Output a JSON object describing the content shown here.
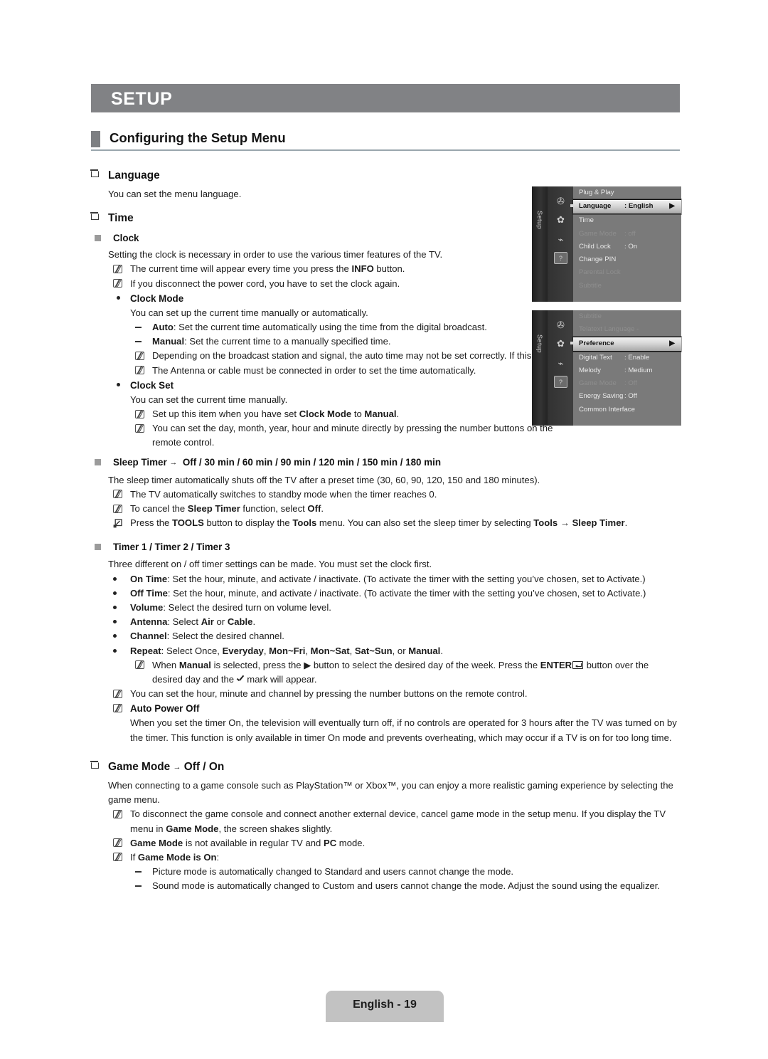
{
  "chapter": {
    "title": "SETUP"
  },
  "section": {
    "title": "Configuring the Setup Menu"
  },
  "footer": {
    "page_label": "English - 19"
  },
  "body": {
    "language": {
      "heading": "Language",
      "desc": "You can set the menu language."
    },
    "time": {
      "heading": "Time",
      "clock": {
        "heading": "Clock",
        "desc": "Setting the clock is necessary in order to use the various timer features of the TV.",
        "note1_a": "The current time will appear every time you press the ",
        "note1_b": "INFO",
        "note1_c": " button.",
        "note2": "If you disconnect the power cord, you have to set the clock again.",
        "clock_mode": {
          "heading": "Clock Mode",
          "desc": "You can set up the current time manually or automatically.",
          "auto_label": "Auto",
          "auto_text": ": Set the current time automatically using the time from the digital broadcast.",
          "manual_label": "Manual",
          "manual_text": ": Set the current time to a manually specified time.",
          "note1": "Depending on the broadcast station and signal, the auto time may not be set correctly. If this occurs, set the time manually.",
          "note2": "The Antenna or cable must be connected in order to set the time automatically."
        },
        "clock_set": {
          "heading": "Clock Set",
          "desc": "You can set the current time manually.",
          "note1_a": "Set up this item when you have set ",
          "note1_b": "Clock Mode",
          "note1_c": " to ",
          "note1_d": "Manual",
          "note1_e": ".",
          "note2": "You can set the day, month, year, hour and minute directly by pressing the number buttons on the remote control."
        }
      },
      "sleep_timer": {
        "heading_label": "Sleep Timer",
        "heading_arrow": "→",
        "heading_options": "Off / 30 min / 60 min / 90 min / 120 min / 150 min / 180 min",
        "desc": "The sleep timer automatically shuts off the TV after a preset time (30, 60, 90, 120, 150 and 180 minutes).",
        "note1": "The TV automatically switches to standby mode when the timer reaches 0.",
        "note2_a": "To cancel the ",
        "note2_b": "Sleep Timer",
        "note2_c": " function, select ",
        "note2_d": "Off",
        "note2_e": ".",
        "tools_a": "Press the ",
        "tools_b": "TOOLS",
        "tools_c": " button to display the ",
        "tools_d": "Tools",
        "tools_e": " menu. You can also set the sleep timer by selecting ",
        "tools_f": "Tools",
        "tools_g": " → ",
        "tools_h": "Sleep Timer",
        "tools_i": "."
      },
      "timers": {
        "heading": "Timer 1 / Timer 2 / Timer 3",
        "desc": "Three different on / off timer settings can be made. You must set the clock first.",
        "items": [
          {
            "label": "On Time",
            "text": ": Set the hour, minute, and activate / inactivate. (To activate the timer with the setting you’ve chosen, set to Activate.)"
          },
          {
            "label": "Off Time",
            "text": ": Set the hour, minute, and activate / inactivate. (To activate the timer with the setting you’ve chosen, set to Activate.)"
          },
          {
            "label": "Volume",
            "text": ": Select the desired turn on volume level."
          }
        ],
        "antenna_label": "Antenna",
        "antenna_a": ": Select ",
        "antenna_b": "Air",
        "antenna_c": " or ",
        "antenna_d": "Cable",
        "antenna_e": ".",
        "channel_label": "Channel",
        "channel_text": ": Select the desired channel.",
        "repeat_label": "Repeat",
        "repeat_a": ": Select Once, ",
        "repeat_b": "Everyday",
        "repeat_c": ", ",
        "repeat_d": "Mon~Fri",
        "repeat_e": ", ",
        "repeat_f": "Mon~Sat",
        "repeat_g": ", ",
        "repeat_h": "Sat~Sun",
        "repeat_i": ", or ",
        "repeat_j": "Manual",
        "repeat_k": ".",
        "manual_note_a": "When ",
        "manual_note_b": "Manual",
        "manual_note_c": " is selected, press the ▶ button to select the desired day of the week. Press the ",
        "manual_note_d": "ENTER",
        "manual_note_e": " button over the desired day and the ",
        "manual_note_f": " mark will appear.",
        "number_note": "You can set the hour, minute and channel by pressing the number buttons on the remote control.",
        "auto_power_off": {
          "heading": "Auto Power Off",
          "desc": "When you set the timer On, the television will eventually turn off, if no controls are operated for 3 hours after the TV was turned on by the timer. This function is only available in timer On mode and prevents overheating, which may occur if a TV is on for too long time."
        }
      }
    },
    "game_mode": {
      "heading_label": "Game Mode",
      "heading_arrow": "→",
      "heading_options": "Off / On",
      "desc": "When connecting to a game console such as PlayStation™ or Xbox™, you can enjoy a more realistic gaming experience by selecting the game menu.",
      "note1_a": "To disconnect the game console and connect another external device, cancel game mode in the setup menu. If you display the TV menu in ",
      "note1_b": "Game Mode",
      "note1_c": ", the screen shakes slightly.",
      "note2_a": "Game Mode",
      "note2_b": " is not available in regular TV and ",
      "note2_c": "PC",
      "note2_d": " mode.",
      "note3_a": "If ",
      "note3_b": "Game Mode is On",
      "note3_c": ":",
      "sub1": "Picture mode is automatically changed to Standard and users cannot change the mode.",
      "sub2": "Sound mode is automatically changed to Custom and users cannot change the mode. Adjust the sound using the equalizer."
    }
  },
  "osd": {
    "rail_label": "Setup",
    "menu1": {
      "items": [
        {
          "label": "Plug & Play",
          "value": "",
          "state": "normal"
        },
        {
          "label": "Language",
          "value": ": English",
          "state": "selected"
        },
        {
          "label": "Time",
          "value": "",
          "state": "normal"
        },
        {
          "label": "Game Mode",
          "value": ": off",
          "state": "dim"
        },
        {
          "label": "Child Lock",
          "value": ": On",
          "state": "normal"
        },
        {
          "label": "Change PIN",
          "value": "",
          "state": "normal"
        },
        {
          "label": "Parental Lock",
          "value": "",
          "state": "dim"
        },
        {
          "label": "Subtitle",
          "value": "",
          "state": "dim"
        }
      ]
    },
    "menu2": {
      "items": [
        {
          "label": "Subtitle",
          "value": "",
          "state": "dim"
        },
        {
          "label": "Telatext Language",
          "value": ": - - -",
          "state": "dim"
        },
        {
          "label": "Preference",
          "value": "",
          "state": "selected"
        },
        {
          "label": "Digital Text",
          "value": ": Enable",
          "state": "normal"
        },
        {
          "label": "Melody",
          "value": ": Medium",
          "state": "normal"
        },
        {
          "label": "Game Mode",
          "value": ": Off",
          "state": "dim"
        },
        {
          "label": "Energy Saving",
          "value": ": Off",
          "state": "normal"
        },
        {
          "label": "Common Interface",
          "value": "",
          "state": "normal"
        }
      ]
    }
  }
}
